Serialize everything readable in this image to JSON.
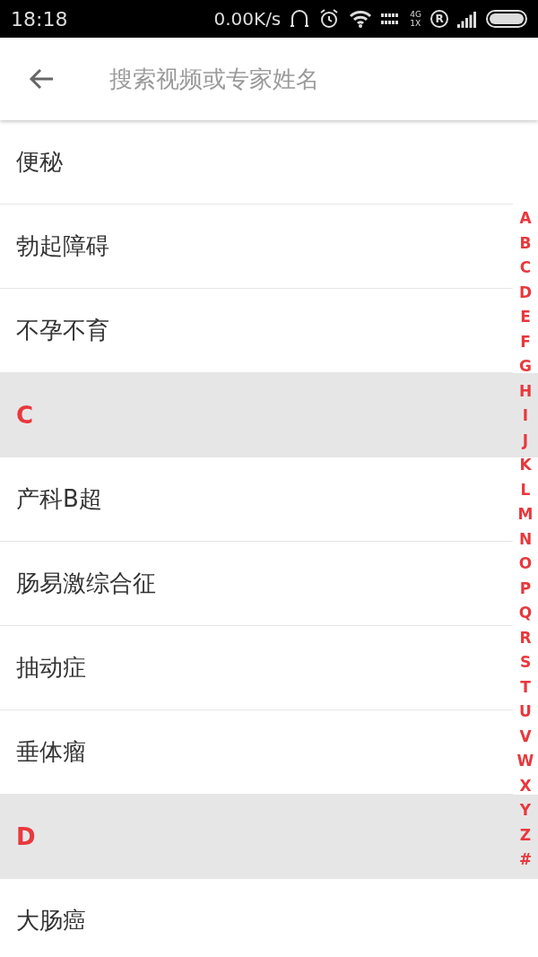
{
  "status_bar": {
    "time": "18:18",
    "speed": "0.00K/s",
    "network_top": "4G",
    "network_bottom": "1X",
    "roaming": "R"
  },
  "search": {
    "placeholder": "搜索视频或专家姓名"
  },
  "list": [
    {
      "kind": "item",
      "label": "便秘"
    },
    {
      "kind": "item",
      "label": "勃起障碍"
    },
    {
      "kind": "item",
      "label": "不孕不育"
    },
    {
      "kind": "header",
      "label": "C"
    },
    {
      "kind": "item",
      "label": "产科B超"
    },
    {
      "kind": "item",
      "label": "肠易激综合征"
    },
    {
      "kind": "item",
      "label": "抽动症"
    },
    {
      "kind": "item",
      "label": "垂体瘤"
    },
    {
      "kind": "header",
      "label": "D"
    },
    {
      "kind": "item",
      "label": "大肠癌"
    }
  ],
  "index": [
    "A",
    "B",
    "C",
    "D",
    "E",
    "F",
    "G",
    "H",
    "I",
    "J",
    "K",
    "L",
    "M",
    "N",
    "O",
    "P",
    "Q",
    "R",
    "S",
    "T",
    "U",
    "V",
    "W",
    "X",
    "Y",
    "Z",
    "#"
  ]
}
